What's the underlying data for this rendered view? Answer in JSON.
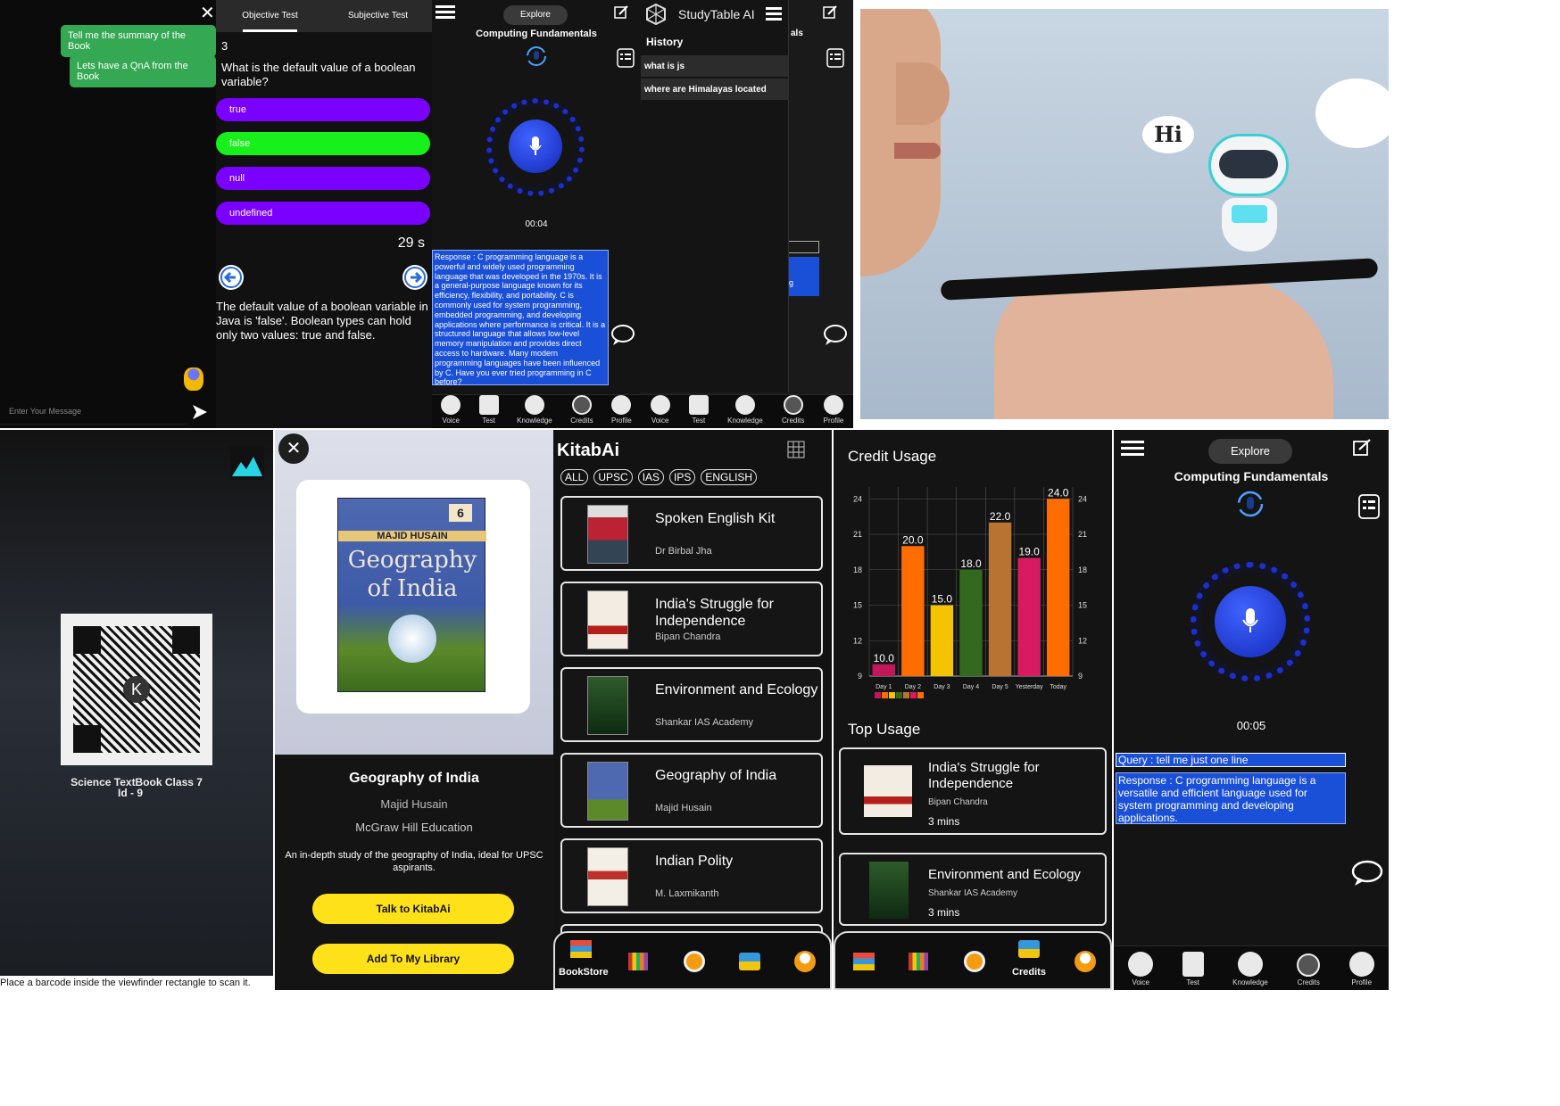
{
  "chat": {
    "suggestions": [
      "Tell me the summary of the Book",
      "Lets have a QnA from the Book"
    ],
    "input_placeholder": "Enter Your Message"
  },
  "quiz": {
    "tabs": [
      "Objective Test",
      "Subjective Test"
    ],
    "qnum": "3",
    "question": "What is the default value of a boolean variable?",
    "options": [
      "true",
      "false",
      "null",
      "undefined"
    ],
    "timer": "29 s",
    "explanation": "The default value of a boolean variable in Java is 'false'. Boolean types can hold only two values: true and false."
  },
  "voice1": {
    "explore": "Explore",
    "title": "Computing Fundamentals",
    "time": "00:04",
    "response": "Response : C programming language is a powerful and widely used programming language that was developed in the 1970s. It is a general-purpose language known for its efficiency, flexibility, and portability. C is commonly used for system programming, embedded programming, and developing applications where performance is critical. It is a structured language that allows low-level memory manipulation and provides direct access to hardware. Many modern programming languages have been influenced by C. Have you ever tried programming in C before?"
  },
  "nav": {
    "voice": "Voice",
    "test": "Test",
    "knowledge": "Knowledge",
    "credits": "Credits",
    "profile": "Profile"
  },
  "history": {
    "app": "StudyTable AI",
    "heading": "History",
    "items": [
      "what is js",
      "where are Himalayas located"
    ],
    "peek_title": "als",
    "peek_btn": "g"
  },
  "hero": {
    "bubble": "Hi"
  },
  "scanner": {
    "label1": "Science TextBook Class 7",
    "label2": "Id - 9",
    "hint": "Place a barcode inside the viewfinder rectangle to scan it."
  },
  "book": {
    "cover_author": "MAJID HUSAIN",
    "cover_title1": "Geography",
    "cover_title2": "of India",
    "cover_ed": "6",
    "title": "Geography of India",
    "author": "Majid Husain",
    "publisher": "McGraw Hill Education",
    "desc": "An in-depth study of the geography of India, ideal for UPSC aspirants.",
    "btn1": "Talk to KitabAi",
    "btn2": "Add To My Library"
  },
  "store": {
    "brand": "KitabAi",
    "filters": [
      "ALL",
      "UPSC",
      "IAS",
      "IPS",
      "ENGLISH"
    ],
    "books": [
      {
        "title": "Spoken English Kit",
        "author": "Dr Birbal Jha"
      },
      {
        "title": "India's Struggle for Independence",
        "author": "Bipan Chandra"
      },
      {
        "title": "Environment and Ecology",
        "author": "Shankar IAS Academy"
      },
      {
        "title": "Geography of India",
        "author": "Majid Husain"
      },
      {
        "title": "Indian Polity",
        "author": "M. Laxmikanth"
      }
    ],
    "nav_bookstore": "BookStore"
  },
  "credits": {
    "heading": "Credit Usage",
    "top_heading": "Top Usage",
    "top": [
      {
        "title": "India's Struggle for Independence",
        "author": "Bipan Chandra",
        "time": "3 mins"
      },
      {
        "title": "Environment and Ecology",
        "author": "Shankar IAS Academy",
        "time": "3 mins"
      }
    ],
    "nav_credits": "Credits"
  },
  "chart_data": {
    "type": "bar",
    "categories": [
      "Day 1",
      "Day 2",
      "Day 3",
      "Day 4",
      "Day 5",
      "Yesterday",
      "Today"
    ],
    "values": [
      10.0,
      20.0,
      15.0,
      18.0,
      22.0,
      19.0,
      24.0
    ],
    "colors": [
      "#c2185b",
      "#ff6d00",
      "#f5c400",
      "#33691e",
      "#b87333",
      "#d81b60",
      "#ff6d00"
    ],
    "yticks": [
      9,
      12,
      15,
      18,
      21,
      24
    ],
    "ylim": [
      9,
      25
    ]
  },
  "voice2": {
    "explore": "Explore",
    "title": "Computing Fundamentals",
    "time": "00:05",
    "query": "Query : tell me just one line",
    "response": "Response : C programming language is a versatile and efficient language used for system programming and developing applications."
  }
}
